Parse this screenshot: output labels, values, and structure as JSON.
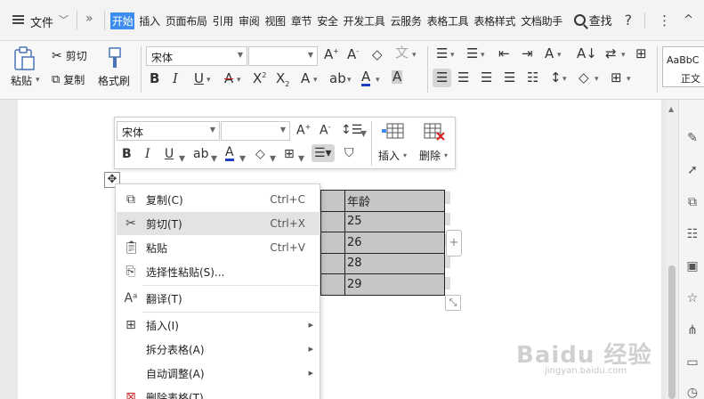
{
  "menubar": {
    "file_label": "文件",
    "more_label": "»",
    "tabs": [
      "开始",
      "插入",
      "页面布局",
      "引用",
      "审阅",
      "视图",
      "章节",
      "安全",
      "开发工具",
      "云服务",
      "表格工具",
      "表格样式",
      "文档助手"
    ],
    "active_tab": "开始",
    "find_label": "查找",
    "help_label": "?",
    "more_menu_label": "⋮",
    "collapse_label": "^"
  },
  "ribbon": {
    "paste_label": "粘贴",
    "cut_label": "剪切",
    "copy_label": "复制",
    "format_painter_label": "格式刷",
    "font_name": "宋体",
    "font_size": "",
    "style_preview": "AaBbC",
    "style_name": "正文"
  },
  "mini_toolbar": {
    "font_name": "宋体",
    "font_size": "",
    "insert_label": "插入",
    "delete_label": "删除"
  },
  "table": {
    "header": "年龄",
    "rows": [
      "25",
      "26",
      "28",
      "29"
    ]
  },
  "context_menu": {
    "items": [
      {
        "label": "复制(C)",
        "shortcut": "Ctrl+C",
        "icon": "copy-icon"
      },
      {
        "label": "剪切(T)",
        "shortcut": "Ctrl+X",
        "icon": "scissors-icon"
      },
      {
        "label": "粘贴",
        "shortcut": "Ctrl+V",
        "icon": "paste-icon"
      },
      {
        "label": "选择性粘贴(S)...",
        "shortcut": "",
        "icon": "paste-special-icon"
      },
      {
        "label": "翻译(T)",
        "shortcut": "",
        "icon": "translate-icon"
      },
      {
        "label": "插入(I)",
        "shortcut": "",
        "icon": "table-insert-icon"
      },
      {
        "label": "拆分表格(A)",
        "shortcut": "",
        "icon": ""
      },
      {
        "label": "自动调整(A)",
        "shortcut": "",
        "icon": ""
      },
      {
        "label": "删除表格(T)",
        "shortcut": "",
        "icon": "table-delete-icon"
      }
    ]
  },
  "watermark": {
    "brand": "Baidu 经验",
    "url": "jingyan.baidu.com"
  },
  "colors": {
    "accent": "#3d8cf0",
    "table_fill": "#c6c6c6",
    "hover": "#e3e3e3"
  }
}
